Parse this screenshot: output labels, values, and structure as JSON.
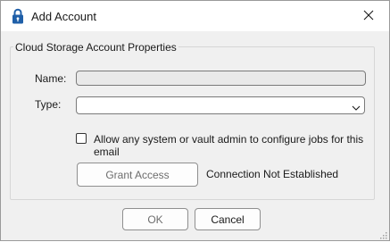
{
  "window": {
    "title": "Add Account",
    "icon": "padlock-icon",
    "close_icon": "close-icon"
  },
  "group": {
    "label": "Cloud Storage Account Properties"
  },
  "form": {
    "name_label": "Name:",
    "name_value": "",
    "type_label": "Type:",
    "type_value": "",
    "allow_admin_label": "Allow any system or vault admin to configure jobs for this email",
    "allow_admin_checked": false,
    "grant_access_label": "Grant Access",
    "connection_status": "Connection Not Established"
  },
  "footer": {
    "ok_label": "OK",
    "cancel_label": "Cancel"
  },
  "colors": {
    "titlebar_bg": "#ffffff",
    "dialog_bg": "#f0f0f0",
    "icon_blue": "#1f5fa8"
  }
}
